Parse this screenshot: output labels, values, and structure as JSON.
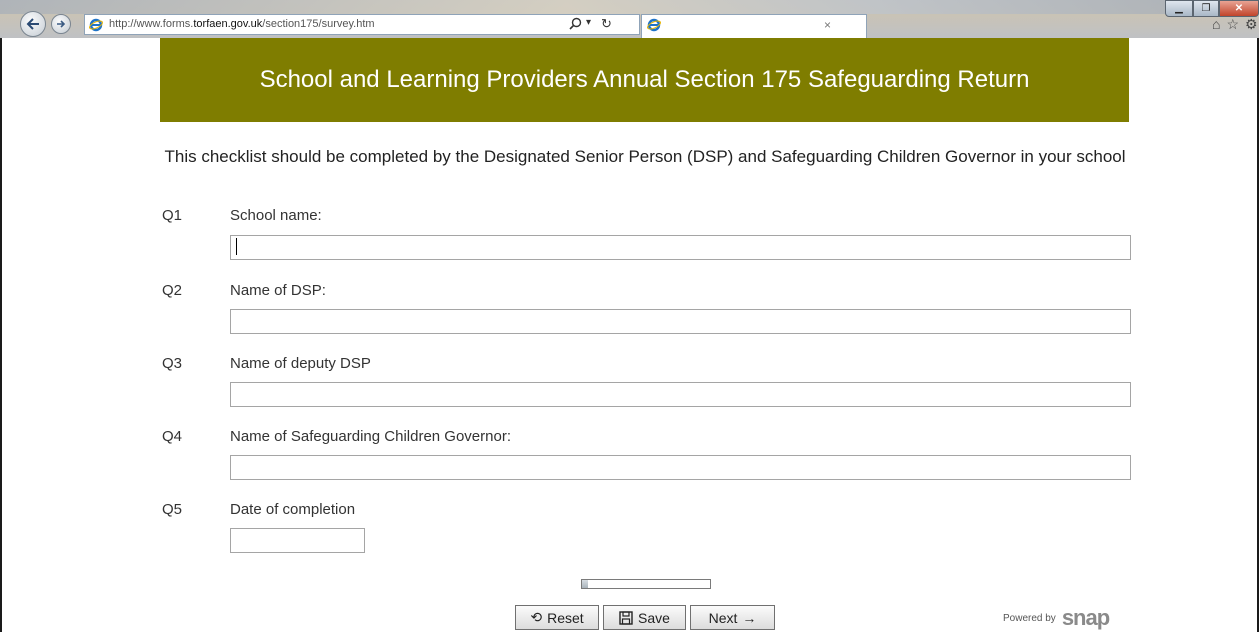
{
  "browser": {
    "url_prefix": "http://www.forms.",
    "url_domain": "torfaen.gov.uk",
    "url_path": "/section175/survey.htm",
    "tab_close": "×"
  },
  "page": {
    "title": "School and Learning Providers Annual Section 175 Safeguarding Return",
    "intro": "This checklist should be completed by the Designated Senior Person (DSP) and Safeguarding Children Governor in your school"
  },
  "questions": [
    {
      "number": "Q1",
      "label": "School name:",
      "value": ""
    },
    {
      "number": "Q2",
      "label": "Name of DSP:",
      "value": ""
    },
    {
      "number": "Q3",
      "label": "Name of deputy DSP",
      "value": ""
    },
    {
      "number": "Q4",
      "label": "Name of Safeguarding Children Governor:",
      "value": ""
    },
    {
      "number": "Q5",
      "label": "Date of completion",
      "value": ""
    }
  ],
  "progress": {
    "fraction": 0.05
  },
  "buttons": {
    "reset": "Reset",
    "save": "Save",
    "next": "Next"
  },
  "footer": {
    "powered_by": "Powered by",
    "logo": "snap"
  },
  "colors": {
    "banner": "#7f7d00"
  }
}
